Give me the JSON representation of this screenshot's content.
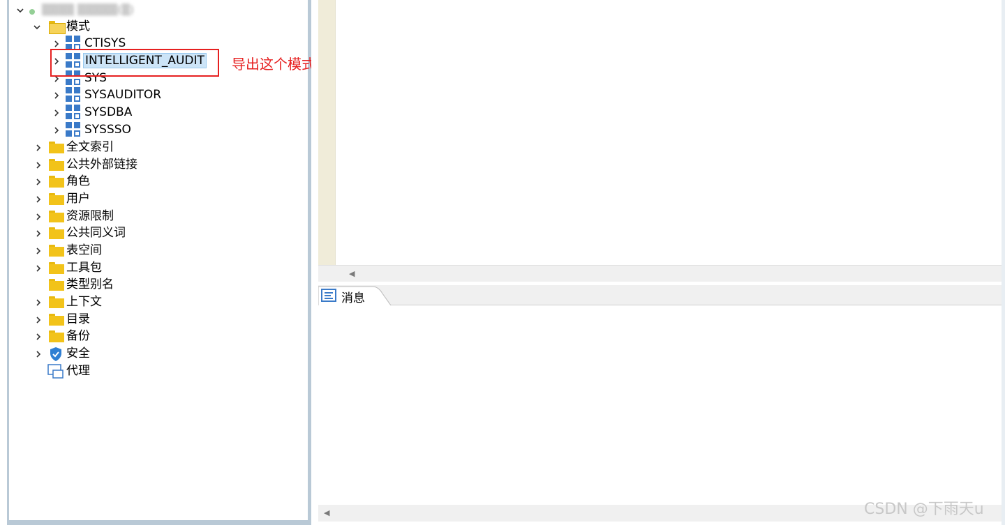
{
  "tree": {
    "root_label": "▒▒▒▒ ▒▒▒▒▒(▒)",
    "schemas_folder": "模式",
    "schemas": [
      "CTISYS",
      "INTELLIGENT_AUDIT",
      "SYS",
      "SYSAUDITOR",
      "SYSDBA",
      "SYSSSO"
    ],
    "selected_schema": "INTELLIGENT_AUDIT",
    "folders": [
      "全文索引",
      "公共外部链接",
      "角色",
      "用户",
      "资源限制",
      "公共同义词",
      "表空间",
      "工具包",
      "类型别名",
      "上下文",
      "目录",
      "备份"
    ],
    "security": "安全",
    "proxy": "代理"
  },
  "annotation": {
    "text": "导出这个模式",
    "color": "#e62020"
  },
  "message_panel": {
    "tab_label": "消息"
  },
  "watermark": "CSDN @下雨天u",
  "colors": {
    "folder": "#f2c31a",
    "schema_icon": "#3a7ac8",
    "panel_border": "#b9c9d6",
    "selection": "#cce4f7"
  }
}
